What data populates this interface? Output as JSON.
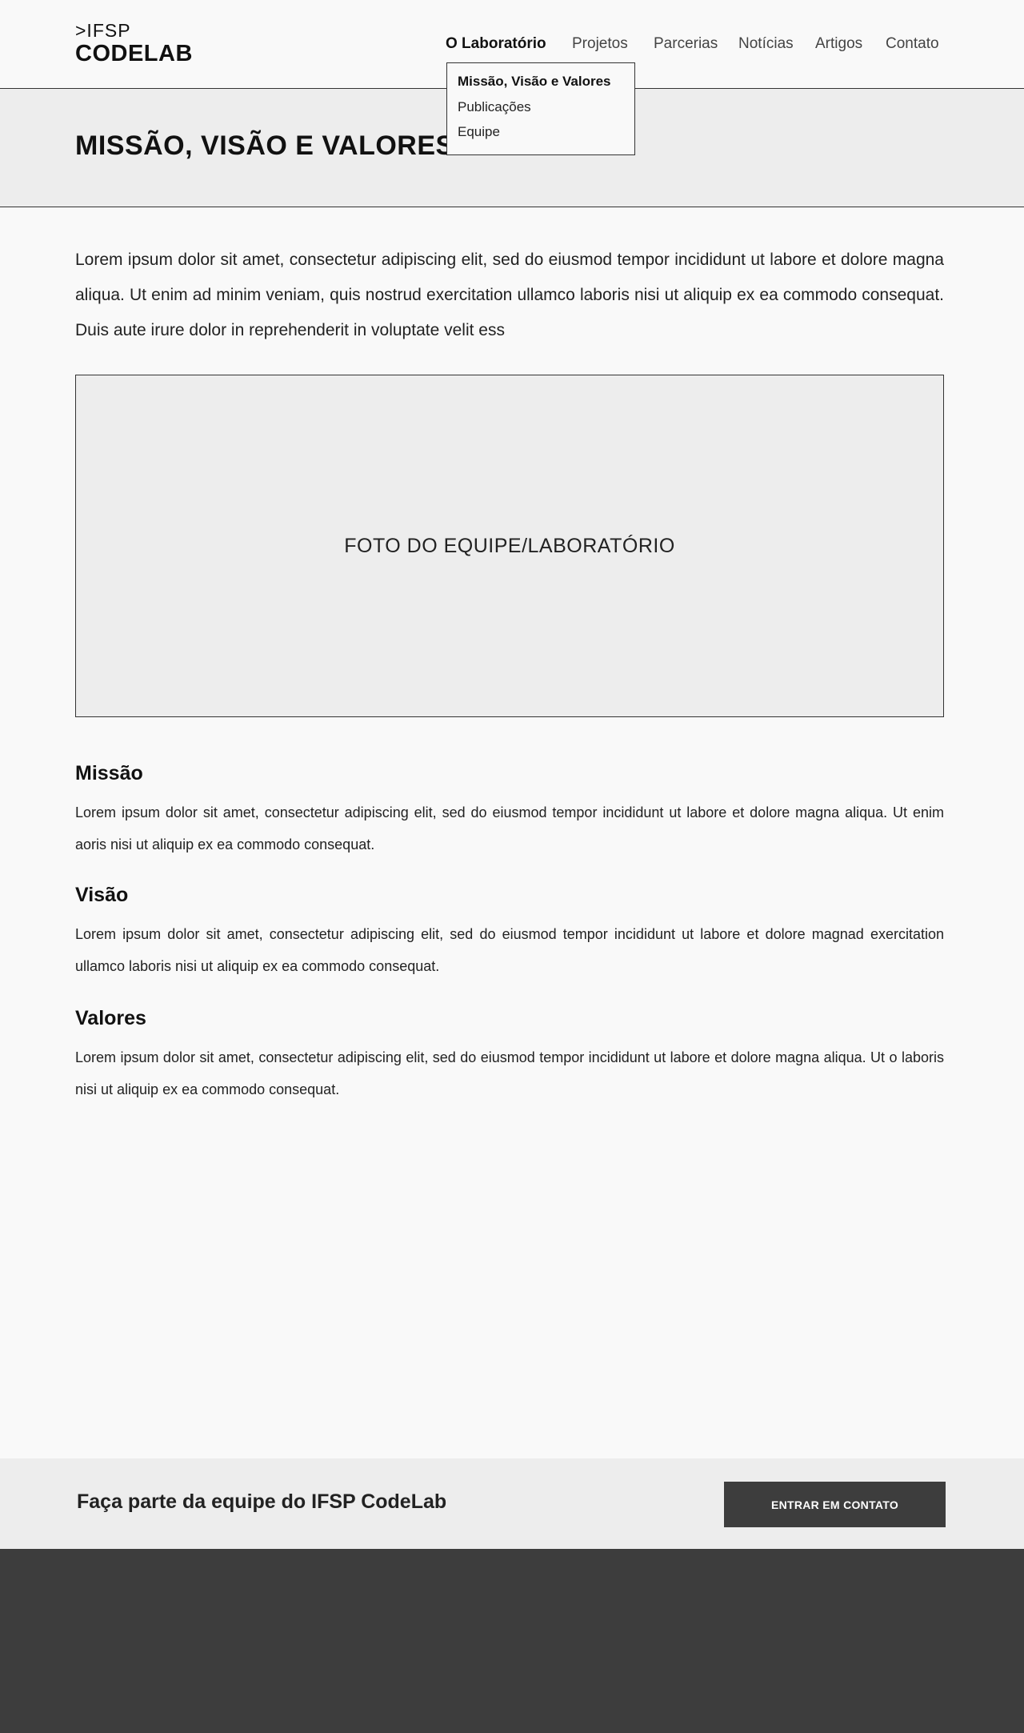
{
  "logo": {
    "line1": ">IFSP",
    "line2": "CODELAB"
  },
  "nav": {
    "items": [
      {
        "label": "O Laboratório",
        "active": true
      },
      {
        "label": "Projetos"
      },
      {
        "label": "Parcerias"
      },
      {
        "label": "Notícias"
      },
      {
        "label": "Artigos"
      },
      {
        "label": "Contato"
      }
    ],
    "dropdown": [
      {
        "label": "Missão, Visão e Valores",
        "selected": true
      },
      {
        "label": "Publicações"
      },
      {
        "label": "Equipe"
      }
    ]
  },
  "banner": {
    "title": "MISSÃO, VISÃO E VALORES"
  },
  "intro": "Lorem ipsum dolor sit amet, consectetur adipiscing elit, sed do eiusmod tempor incididunt ut labore et dolore magna aliqua. Ut enim ad minim veniam, quis nostrud exercitation ullamco laboris nisi ut aliquip ex ea commodo consequat. Duis aute irure dolor in reprehenderit in voluptate velit ess",
  "photo": {
    "label": "FOTO DO EQUIPE/LABORATÓRIO"
  },
  "sections": [
    {
      "heading": "Missão",
      "text": "Lorem ipsum dolor sit amet, consectetur adipiscing elit, sed do eiusmod tempor incididunt ut labore et dolore magna aliqua. Ut enim aoris nisi ut aliquip ex ea commodo consequat."
    },
    {
      "heading": "Visão",
      "text": "Lorem ipsum dolor sit amet, consectetur adipiscing elit, sed do eiusmod tempor incididunt ut labore et dolore magnad exercitation ullamco laboris nisi ut aliquip ex ea commodo consequat."
    },
    {
      "heading": "Valores",
      "text": "Lorem ipsum dolor sit amet, consectetur adipiscing elit, sed do eiusmod tempor incididunt ut labore et dolore magna aliqua. Ut o laboris nisi ut aliquip ex ea commodo consequat."
    }
  ],
  "cta": {
    "text": "Faça parte da equipe do IFSP CodeLab",
    "button_label": "ENTRAR EM CONTATO"
  }
}
